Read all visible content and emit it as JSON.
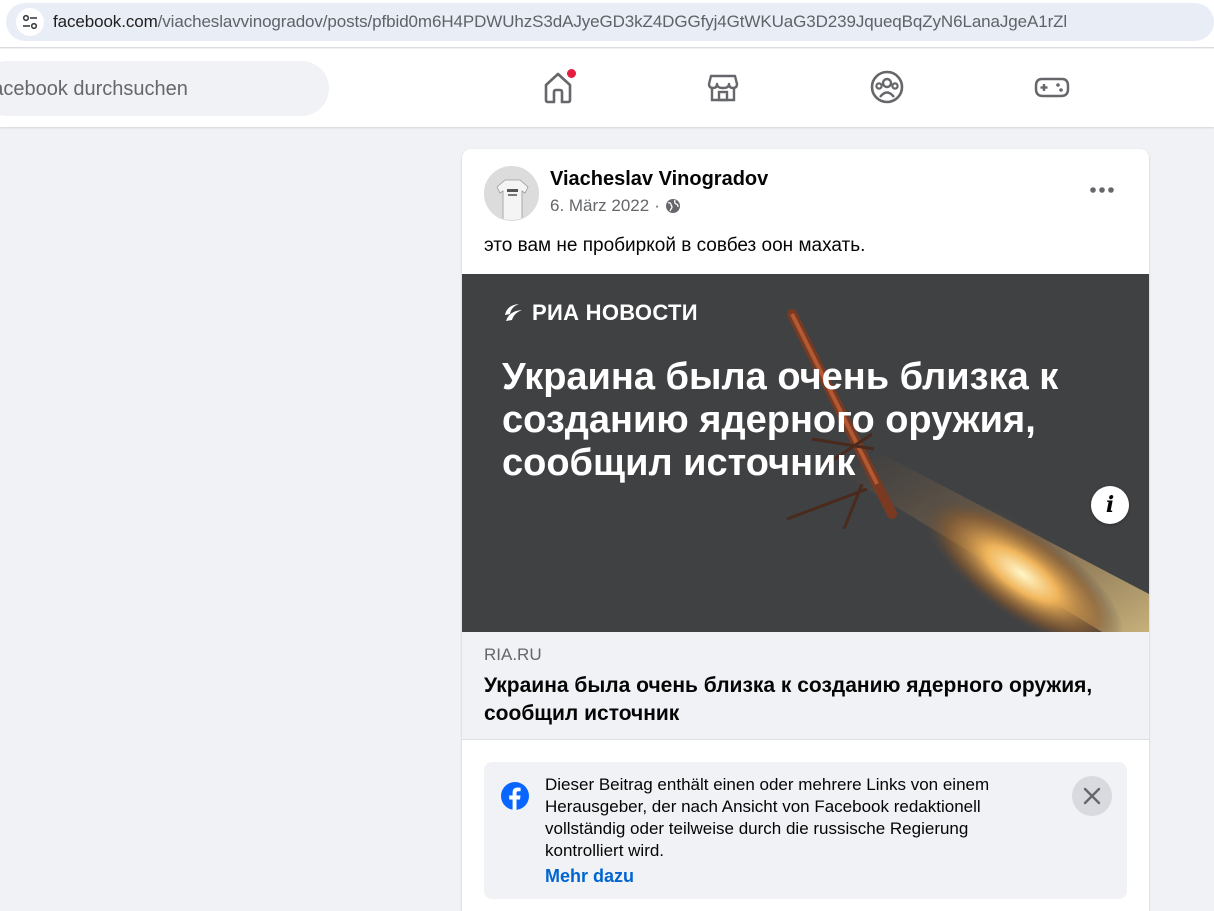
{
  "browser": {
    "url_host": "facebook.com",
    "url_path": "/viacheslavvinogradov/posts/pfbid0m6H4PDWUhzS3dAJyeGD3kZ4DGGfyj4GtWKUaG3D239JqueqBqZyN6LanaJgeA1rZl"
  },
  "nav": {
    "search_placeholder": "Facebook durchsuchen",
    "icons": [
      "home-icon",
      "marketplace-icon",
      "groups-icon",
      "gaming-icon"
    ],
    "home_notification": true
  },
  "post": {
    "author": "Viacheslav Vinogradov",
    "date": "6. März 2022",
    "separator": "·",
    "privacy_icon": "globe-icon",
    "text": "это вам не пробиркой в совбез оон махать.",
    "link_preview": {
      "logo_text": "РИА НОВОСТИ",
      "image_headline": "Украина была очень близка к созданию ядерного оружия, сообщил источник",
      "info_label": "i",
      "domain": "RIA.RU",
      "title": "Украина была очень близка к созданию ядерного оружия, сообщил источник"
    },
    "notice": {
      "text": "Dieser Beitrag enthält einen oder mehrere Links von einem Herausgeber, der nach Ansicht von Facebook redaktionell vollständig oder teilweise durch die russische Regierung kontrolliert wird.",
      "link": "Mehr dazu"
    }
  },
  "colors": {
    "page_bg": "#f0f2f5",
    "facebook_blue": "#0866ff",
    "link_blue": "#0064d1",
    "notification_red": "#e41e3f",
    "image_bg": "#404143"
  }
}
